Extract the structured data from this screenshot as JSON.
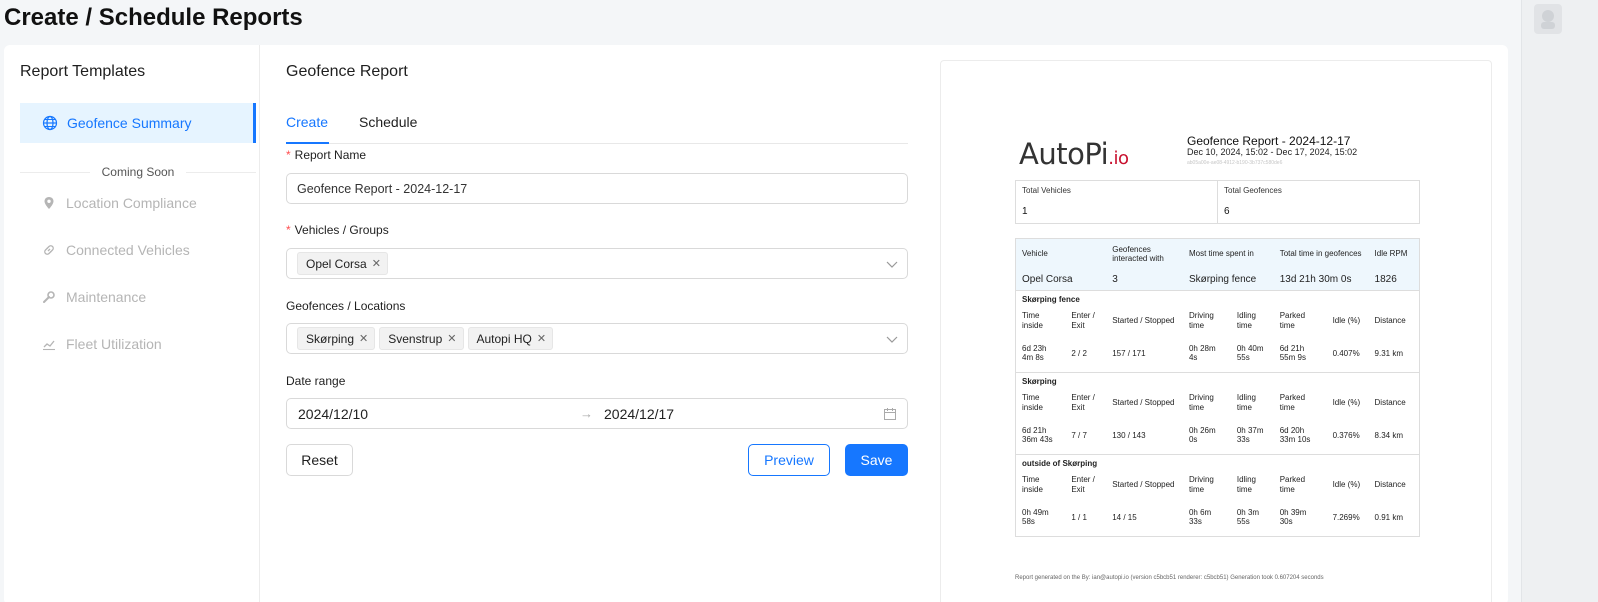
{
  "page": {
    "title": "Create / Schedule Reports"
  },
  "sidebar": {
    "title": "Report Templates",
    "active_item": {
      "label": "Geofence Summary",
      "icon": "globe-icon"
    },
    "divider_label": "Coming Soon",
    "items": [
      {
        "label": "Location Compliance",
        "icon": "map-pin-icon"
      },
      {
        "label": "Connected Vehicles",
        "icon": "link-icon"
      },
      {
        "label": "Maintenance",
        "icon": "wrench-icon"
      },
      {
        "label": "Fleet Utilization",
        "icon": "line-chart-icon"
      }
    ]
  },
  "form": {
    "title": "Geofence Report",
    "tabs": [
      {
        "label": "Create",
        "active": true
      },
      {
        "label": "Schedule",
        "active": false
      }
    ],
    "report_name": {
      "label": "Report Name",
      "required": true,
      "value": "Geofence Report - 2024-12-17"
    },
    "vehicles": {
      "label": "Vehicles / Groups",
      "required": true,
      "tags": [
        "Opel Corsa"
      ]
    },
    "geofences": {
      "label": "Geofences / Locations",
      "required": false,
      "tags": [
        "Skørping",
        "Svenstrup",
        "Autopi HQ"
      ]
    },
    "date_range": {
      "label": "Date range",
      "start": "2024/12/10",
      "end": "2024/12/17",
      "separator": "→"
    },
    "buttons": {
      "reset": "Reset",
      "preview": "Preview",
      "save": "Save"
    }
  },
  "preview": {
    "logo": {
      "text": "AutoPi",
      "suffix": ".io"
    },
    "title": "Geofence Report - 2024-12-17",
    "subtitle": "Dec 10, 2024, 15:02 - Dec 17, 2024, 15:02",
    "report_id": "ab05a00e-ae08-4912-b190-3b737c580de6",
    "summary": [
      {
        "label": "Total Vehicles",
        "value": "1"
      },
      {
        "label": "Total Geofences",
        "value": "6"
      }
    ],
    "table_headers": [
      "Vehicle",
      "Geofences interacted with",
      "Most time spent in",
      "Total time in geofences",
      "Idle RPM"
    ],
    "vehicle_row": [
      "Opel Corsa",
      "3",
      "Skørping fence",
      "13d 21h 30m 0s",
      "1826"
    ],
    "group_headers": [
      "Time inside",
      "Enter / Exit",
      "Started / Stopped",
      "Driving time",
      "Idling time",
      "Parked time",
      "Idle (%)",
      "Distance"
    ],
    "groups": [
      {
        "name": "Skørping fence",
        "values": [
          "6d 23h 4m 8s",
          "2 / 2",
          "157 / 171",
          "0h 28m 4s",
          "0h 40m 55s",
          "6d 21h 55m 9s",
          "0.407%",
          "9.31 km"
        ]
      },
      {
        "name": "Skørping",
        "values": [
          "6d 21h 36m 43s",
          "7 / 7",
          "130 / 143",
          "0h 26m 0s",
          "0h 37m 33s",
          "6d 20h 33m 10s",
          "0.376%",
          "8.34 km"
        ]
      },
      {
        "name": "outside of Skørping",
        "values": [
          "0h 49m 58s",
          "1 / 1",
          "14 / 15",
          "0h 6m 33s",
          "0h 3m 55s",
          "0h 39m 30s",
          "7.269%",
          "0.91 km"
        ]
      }
    ],
    "footer": "Report generated on the By: ian@autopi.io (version c5bcb51 renderer: c5bcb51) Generation took 0.607204 seconds"
  },
  "colors": {
    "accent": "#1677ff",
    "danger": "#ff4d4f",
    "brand_red": "#c8102e"
  }
}
